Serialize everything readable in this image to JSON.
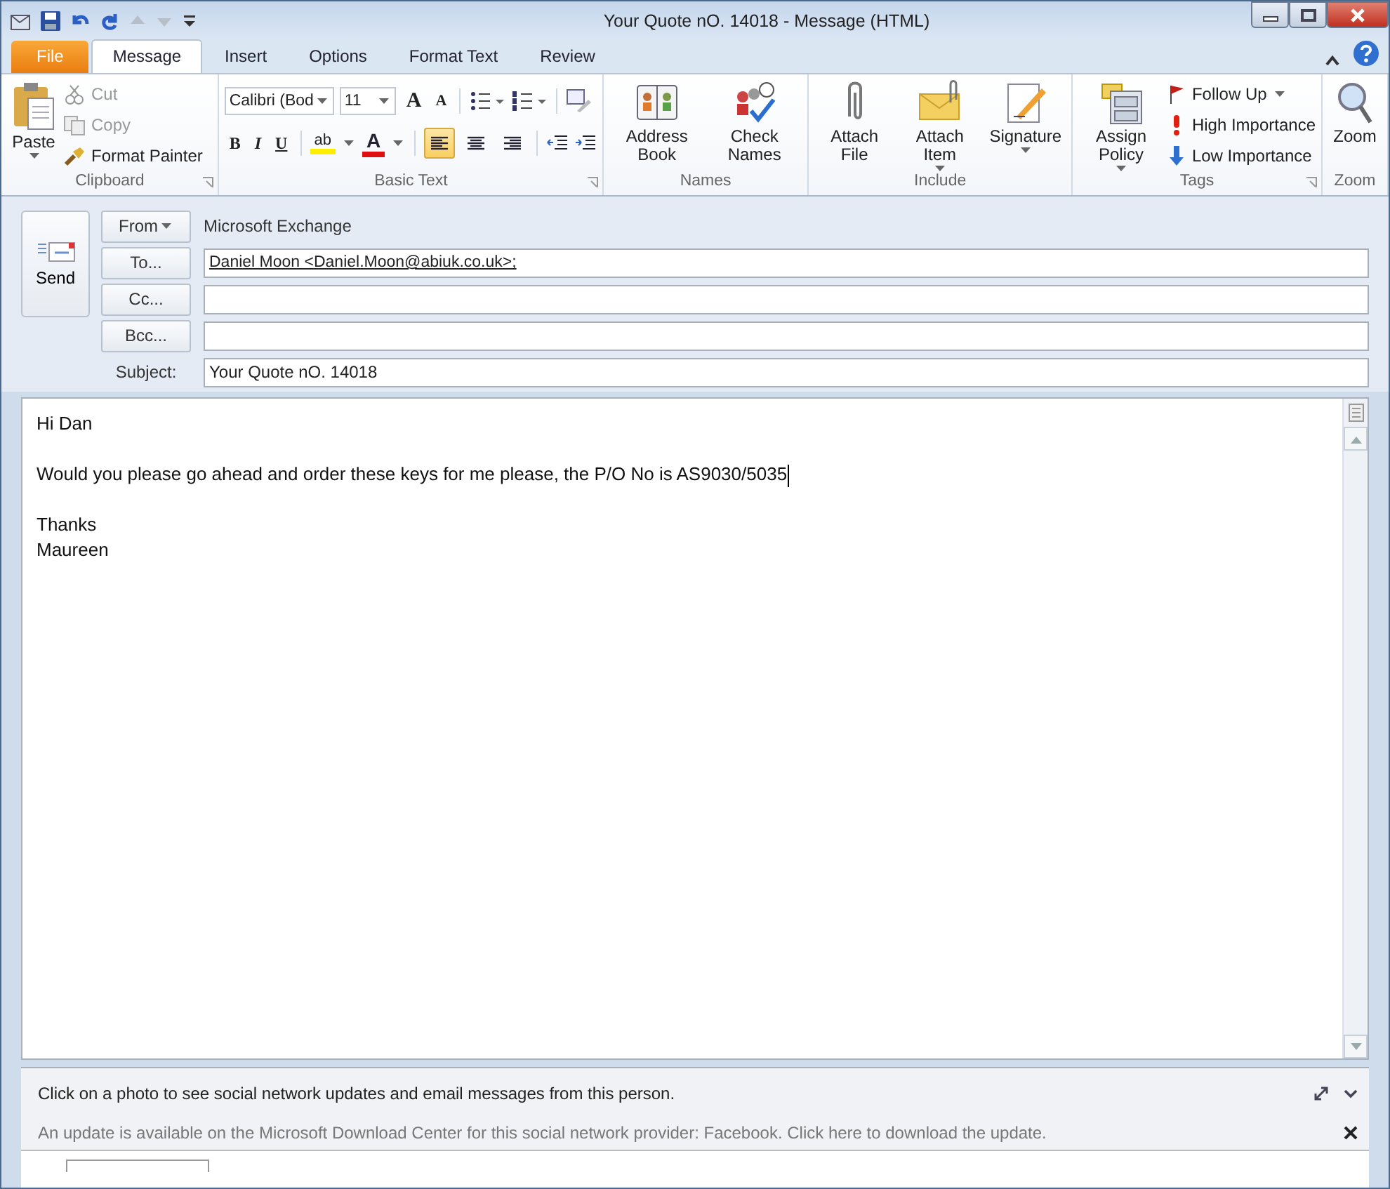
{
  "window": {
    "title": "Your Quote nO.  14018  -  Message (HTML)"
  },
  "tabs": [
    {
      "label": "File",
      "kind": "file",
      "selected": false
    },
    {
      "label": "Message",
      "kind": "tab",
      "selected": true
    },
    {
      "label": "Insert",
      "kind": "tab",
      "selected": false
    },
    {
      "label": "Options",
      "kind": "tab",
      "selected": false
    },
    {
      "label": "Format Text",
      "kind": "tab",
      "selected": false
    },
    {
      "label": "Review",
      "kind": "tab",
      "selected": false
    }
  ],
  "clipboard": {
    "paste": "Paste",
    "items": [
      {
        "label": "Cut",
        "kind": "cut",
        "disabled": true
      },
      {
        "label": "Copy",
        "kind": "copy",
        "disabled": true
      },
      {
        "label": "Format Painter",
        "kind": "painter",
        "disabled": false
      }
    ],
    "group": "Clipboard"
  },
  "basic_text": {
    "font": "Calibri (Bod",
    "size": "11",
    "grow": "A",
    "shrink": "A",
    "styles": [
      {
        "glyph": "B",
        "kind": "bold"
      },
      {
        "glyph": "I",
        "kind": "italic"
      },
      {
        "glyph": "U",
        "kind": "underline"
      }
    ],
    "highlight": "ab",
    "font_color": "A",
    "align": [
      {
        "kind": "left",
        "selected": true
      },
      {
        "kind": "center",
        "selected": false
      },
      {
        "kind": "right",
        "selected": false
      }
    ],
    "group": "Basic Text"
  },
  "names": {
    "buttons": [
      {
        "label": "Address Book",
        "kind": "book"
      },
      {
        "label": "Check Names",
        "kind": "check"
      }
    ],
    "group": "Names"
  },
  "include": {
    "buttons": [
      {
        "label": "Attach File",
        "kind": "clip",
        "dropdown": false
      },
      {
        "label": "Attach Item",
        "kind": "envelope",
        "dropdown": true
      },
      {
        "label": "Signature",
        "kind": "pen",
        "dropdown": true
      }
    ],
    "group": "Include"
  },
  "tags": {
    "policy": "Assign Policy",
    "items": [
      {
        "label": "Follow Up",
        "kind": "flag",
        "dropdown": true
      },
      {
        "label": "High Importance",
        "kind": "high",
        "dropdown": false
      },
      {
        "label": "Low Importance",
        "kind": "low",
        "dropdown": false
      }
    ],
    "group": "Tags"
  },
  "zoom": {
    "button": "Zoom",
    "group": "Zoom"
  },
  "header": {
    "send": "Send",
    "from": {
      "button": "From",
      "value": "Microsoft Exchange"
    },
    "recipients": [
      {
        "button": "To...",
        "value": "Daniel Moon <Daniel.Moon@abiuk.co.uk>;"
      },
      {
        "button": "Cc..."
      },
      {
        "button": "Bcc..."
      }
    ],
    "subject": {
      "label": "Subject:",
      "value": "Your Quote nO.  14018"
    }
  },
  "body": {
    "paragraphs": [
      [
        "Hi Dan"
      ],
      [
        "Would you please go ahead and order these keys for me please, the P/O No is AS9030/5035"
      ],
      [
        "Thanks",
        "Maureen"
      ]
    ]
  },
  "people_pane": {
    "message": "Click on a photo to see social network updates and email messages from this person.",
    "notice": "An update is available on the Microsoft Download Center for this social network provider: Facebook. Click here to download the update."
  }
}
